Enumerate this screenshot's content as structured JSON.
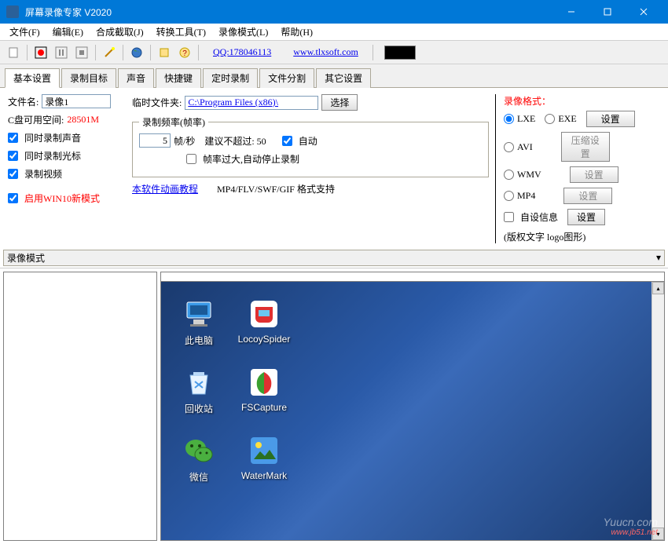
{
  "window": {
    "title": "屏幕录像专家 V2020"
  },
  "menu": [
    "文件(F)",
    "编辑(E)",
    "合成截取(J)",
    "转换工具(T)",
    "录像模式(L)",
    "帮助(H)"
  ],
  "toolbar": {
    "qq_label": "QQ:178046113",
    "url_label": "www.tlxsoft.com"
  },
  "tabs": [
    "基本设置",
    "录制目标",
    "声音",
    "快捷键",
    "定时录制",
    "文件分割",
    "其它设置"
  ],
  "settings": {
    "filename_label": "文件名:",
    "filename_value": "录像1",
    "tempdir_label": "临时文件夹:",
    "tempdir_value": "C:\\Program Files (x86)\\",
    "select_btn": "选择",
    "diskspace_label": "C盘可用空间:",
    "diskspace_value": "28501M",
    "cb_record_sound": "同时录制声音",
    "cb_record_cursor": "同时录制光标",
    "cb_record_video": "录制视频",
    "cb_win10_mode": "启用WIN10新模式",
    "tutorial_link": "本软件动画教程",
    "format_support": "MP4/FLV/SWF/GIF 格式支持",
    "framerate": {
      "legend": "录制频率(帧率)",
      "fps_value": "5",
      "fps_unit": "帧/秒",
      "suggest": "建议不超过: 50",
      "auto": "自动",
      "overflow_stop": "帧率过大,自动停止录制"
    },
    "format": {
      "legend": "录像格式：",
      "lxe": "LXE",
      "exe": "EXE",
      "avi": "AVI",
      "wmv": "WMV",
      "mp4": "MP4",
      "set_btn": "设置",
      "compress_btn": "压缩设置",
      "custom_info": "自设信息",
      "copyright": "(版权文字 logo图形)"
    }
  },
  "mode_bar": "录像模式",
  "desktop": {
    "icons": [
      {
        "name": "此电脑"
      },
      {
        "name": "LocoySpider"
      },
      {
        "name": "回收站"
      },
      {
        "name": "FSCapture"
      },
      {
        "name": "微信"
      },
      {
        "name": "WaterMark"
      }
    ]
  },
  "watermark": {
    "main": "Yuucn.com",
    "sub": "www.jb51.net"
  }
}
